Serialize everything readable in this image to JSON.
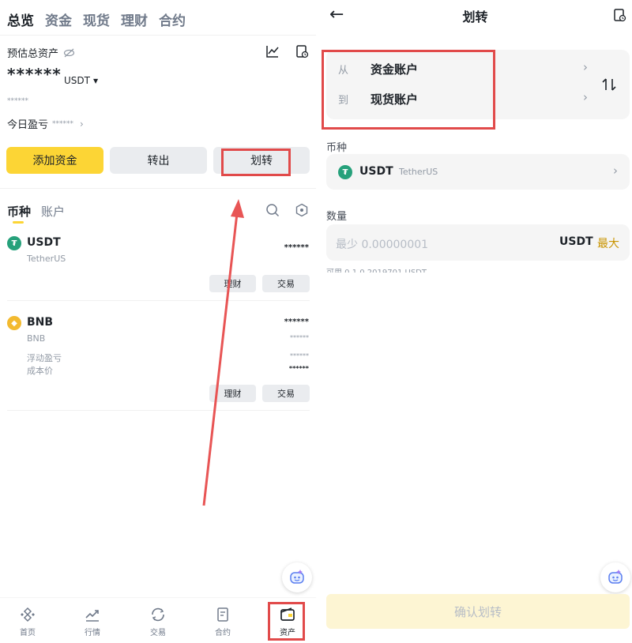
{
  "left": {
    "tabs": [
      "总览",
      "资金",
      "现货",
      "理财",
      "合约"
    ],
    "estimated_label": "预估总资产",
    "total_masked": "******",
    "currency": "USDT",
    "fiat_masked": "******",
    "pnl_label": "今日盈亏",
    "pnl_masked": "******",
    "buttons": {
      "add_funds": "添加资金",
      "withdraw": "转出",
      "transfer": "划转"
    },
    "list_tabs": {
      "coins": "币种",
      "accounts": "账户"
    },
    "assets": [
      {
        "symbol": "USDT",
        "name": "TetherUS",
        "amount": "******",
        "btn_earn": "理财",
        "btn_trade": "交易"
      },
      {
        "symbol": "BNB",
        "name": "BNB",
        "amount": "******",
        "sub_value": "******",
        "floating_label": "浮动盈亏",
        "floating_value": "******",
        "cost_label": "成本价",
        "cost_value": "******",
        "btn_earn": "理财",
        "btn_trade": "交易"
      }
    ],
    "nav": [
      {
        "label": "首页",
        "icon": "home-icon"
      },
      {
        "label": "行情",
        "icon": "markets-icon"
      },
      {
        "label": "交易",
        "icon": "trade-icon"
      },
      {
        "label": "合约",
        "icon": "futures-icon"
      },
      {
        "label": "资产",
        "icon": "wallet-icon"
      }
    ]
  },
  "right": {
    "title": "划转",
    "from_label": "从",
    "from_account": "资金账户",
    "to_label": "到",
    "to_account": "现货账户",
    "coin_label": "币种",
    "coin_symbol": "USDT",
    "coin_name": "TetherUS",
    "amount_label": "数量",
    "amount_placeholder": "最少 0.00000001",
    "amount_unit": "USDT",
    "max_label": "最大",
    "available_label": "可用 0.1.0.2019701 USDT",
    "confirm_button": "确认划转"
  },
  "colors": {
    "brand_yellow": "#fcd535",
    "highlight_red": "#e14a4a",
    "max_gold": "#c99400",
    "usdt_green": "#26a17b",
    "bnb_yellow": "#f3ba2f"
  }
}
